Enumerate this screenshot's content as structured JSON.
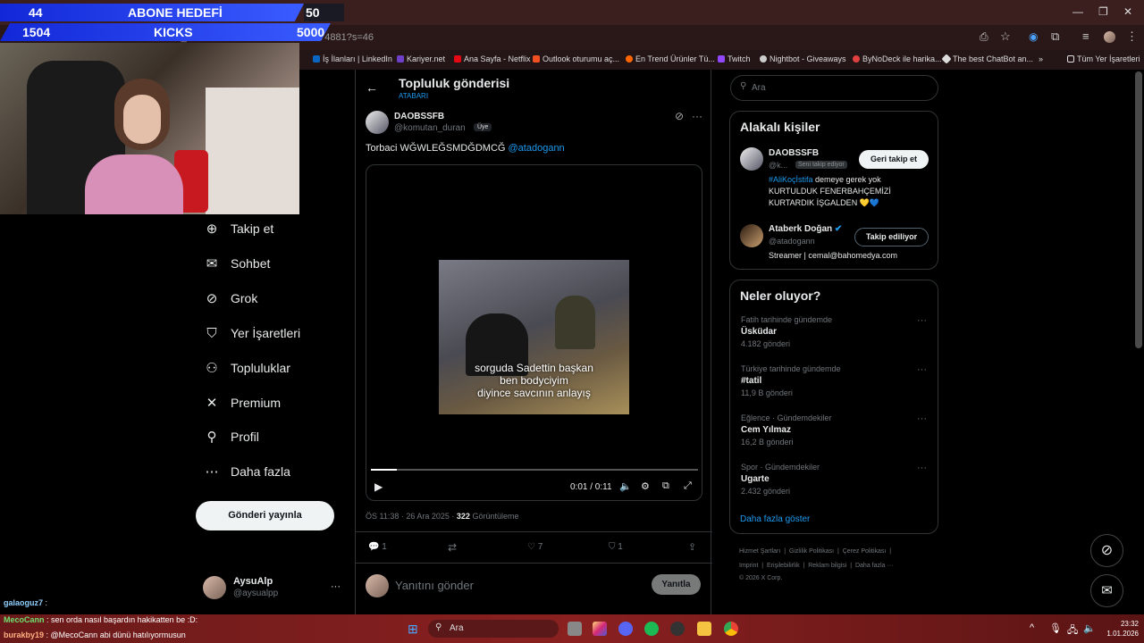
{
  "overlay": {
    "goal_left1": "44",
    "goal_title": "ABONE HEDEFİ",
    "goal_right1": "50",
    "goal_left2": "1504",
    "goal_title2": "KICKS",
    "goal_right2": "5000"
  },
  "browser": {
    "url": "x.com/komutan_duran/status/2004653036871174881?s=46",
    "bookmarks": [
      "İş İlanları | LinkedIn",
      "Kariyer.net",
      "Ana Sayfa - Netflix",
      "Outlook oturumu aç...",
      "En Trend Ürünler Tü...",
      "Twitch",
      "Nightbot - Giveaways",
      "ByNoDeck ile harika...",
      "The best ChatBot an...",
      "»",
      "Tüm Yer İşaretleri"
    ],
    "bookmark_colors": [
      "#0a66c2",
      "#6e3fc8",
      "#e50914",
      "#f25022",
      "#ff6600",
      "#9146ff",
      "#ccc",
      "#e04040",
      "#ddd",
      "#ddd",
      "#ddd"
    ]
  },
  "nav": {
    "items": [
      {
        "label": "Takip et",
        "icon": "person-add-icon",
        "glyph": "⊕"
      },
      {
        "label": "Sohbet",
        "icon": "mail-icon",
        "glyph": "✉"
      },
      {
        "label": "Grok",
        "icon": "grok-icon",
        "glyph": "⊘"
      },
      {
        "label": "Yer İşaretleri",
        "icon": "bookmark-icon",
        "glyph": "⛉"
      },
      {
        "label": "Topluluklar",
        "icon": "communities-icon",
        "glyph": "⚇"
      },
      {
        "label": "Premium",
        "icon": "x-logo-icon",
        "glyph": "✕"
      },
      {
        "label": "Profil",
        "icon": "person-icon",
        "glyph": "⚲"
      },
      {
        "label": "Daha fazla",
        "icon": "more-circle-icon",
        "glyph": "⋯"
      }
    ],
    "post_button": "Gönderi yayınla",
    "user_name": "AysuAlp",
    "user_handle": "@aysualpp",
    "user_more": "···"
  },
  "post": {
    "header_title": "Topluluk gönderisi",
    "header_sub": "ATABARI",
    "author_name": "DAOBSSFB",
    "author_handle": "@komutan_duran",
    "badge": "Üye",
    "text_prefix": "Torbaci WĞWLEĞSMDĞDMCĞ ",
    "mention": "@atadogann",
    "subtitle_lines": [
      "sorguda Sadettin başkan",
      "ben bodyciyim",
      "diyince savcının anlayış"
    ],
    "video_time": "0:01 / 0:11",
    "video_progress": 0.08,
    "meta_time": "ÖS 11:38 · 26 Ara 2025 · ",
    "views_count": "322",
    "views_label": " Görüntüleme",
    "replies": "1",
    "likes": "7",
    "bookmarks": "1",
    "reply_placeholder": "Yanıtını gönder",
    "reply_button": "Yanıtla"
  },
  "sidebar": {
    "search_placeholder": "Ara",
    "related_title": "Alakalı kişiler",
    "person1_name": "DAOBSSFB",
    "person1_handle": "@k...",
    "person1_badge": "Seni takip ediyor",
    "person1_button": "Geri takip et",
    "person1_bio_hashtag": "#AliKoçİstifa",
    "person1_bio_rest": " demeye gerek yok KURTULDUK FENERBAHÇEMİZİ KURTARDIK İŞGALDEN 💛💙",
    "person2_name": "Ataberk Doğan",
    "person2_handle": "@atadogann",
    "person2_button": "Takip ediliyor",
    "person2_bio": "Streamer | cemal@bahomedya.com",
    "trends_title": "Neler oluyor?",
    "trends": [
      {
        "context": "Fatih tarihinde gündemde",
        "name": "Üsküdar",
        "count": "4.182 gönderi"
      },
      {
        "context": "Türkiye tarihinde gündemde",
        "name": "#tatil",
        "count": "11,9 B gönderi"
      },
      {
        "context": "Eğlence · Gündemdekiler",
        "name": "Cem Yılmaz",
        "count": "16,2 B gönderi"
      },
      {
        "context": "Spor · Gündemdekiler",
        "name": "Ugarte",
        "count": "2.432 gönderi"
      }
    ],
    "show_more": "Daha fazla göster",
    "footer_row1": [
      "Hizmet Şartları",
      "|",
      "Gizlilik Politikası",
      "|",
      "Çerez Politikası",
      "|"
    ],
    "footer_row2": [
      "Imprint",
      "|",
      "Erişilebilirlik",
      "|",
      "Reklam bilgisi",
      "|",
      "Daha fazla ···"
    ],
    "copyright": "© 2026 X Corp."
  },
  "chat": {
    "line0_user": "galaoguz7",
    "line0_text": " :",
    "line1_user": "MecoCann",
    "line1_text": " : sen orda nasıl başardın hakikatten be :D:",
    "line2_user": "burakby19",
    "line2_text": " : @MecoCann abi dünü hatılıyormusun"
  },
  "taskbar": {
    "search": "Ara",
    "time": "23:32",
    "date": "1.01.2026"
  }
}
